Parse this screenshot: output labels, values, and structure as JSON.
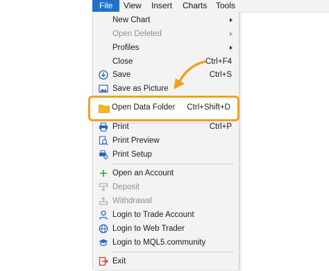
{
  "menubar": {
    "file": "File",
    "view": "View",
    "insert": "Insert",
    "charts": "Charts",
    "tools": "Tools"
  },
  "menu": {
    "new_chart": "New Chart",
    "open_deleted": "Open Deleted",
    "profiles": "Profiles",
    "close": "Close",
    "close_shortcut": "Ctrl+F4",
    "save": "Save",
    "save_shortcut": "Ctrl+S",
    "save_as_picture": "Save as Picture",
    "open_data_folder": "Open Data Folder",
    "open_data_folder_shortcut": "Ctrl+Shift+D",
    "print": "Print",
    "print_shortcut": "Ctrl+P",
    "print_preview": "Print Preview",
    "print_setup": "Print Setup",
    "open_account": "Open an Account",
    "deposit": "Deposit",
    "withdrawal": "Withdrawal",
    "login_trade_account": "Login to Trade Account",
    "login_web_trader": "Login to Web Trader",
    "login_mql5": "Login to MQL5.community",
    "exit": "Exit"
  },
  "colors": {
    "menu_active": "#1e73c8",
    "highlight_border": "#f0a020",
    "icon_blue": "#2a66b8",
    "icon_green": "#2e9d3a",
    "folder_yellow": "#f3b61f",
    "exit_red": "#c0392b"
  }
}
